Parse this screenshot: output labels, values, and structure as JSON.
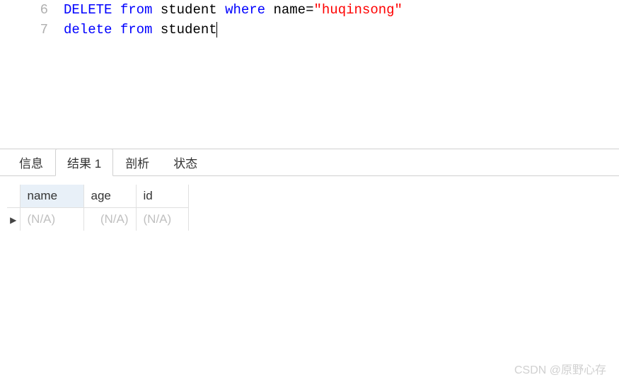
{
  "editor": {
    "lines": [
      {
        "num": "6",
        "tokens": [
          {
            "t": "DELETE",
            "c": "kw"
          },
          {
            "t": " ",
            "c": "ident"
          },
          {
            "t": "from",
            "c": "kw"
          },
          {
            "t": " student ",
            "c": "ident"
          },
          {
            "t": "where",
            "c": "kw"
          },
          {
            "t": " name",
            "c": "ident"
          },
          {
            "t": "=",
            "c": "ident"
          },
          {
            "t": "\"huqinsong\"",
            "c": "str"
          }
        ]
      },
      {
        "num": "7",
        "tokens": [
          {
            "t": "delete from",
            "c": "kw"
          },
          {
            "t": " student",
            "c": "ident"
          }
        ],
        "cursor": true
      }
    ]
  },
  "tabs": {
    "items": [
      {
        "label": "信息",
        "active": false
      },
      {
        "label": "结果 1",
        "active": true
      },
      {
        "label": "剖析",
        "active": false
      },
      {
        "label": "状态",
        "active": false
      }
    ]
  },
  "results": {
    "columns": [
      "name",
      "age",
      "id"
    ],
    "selected_column": 0,
    "rows": [
      {
        "name": "(N/A)",
        "age": "(N/A)",
        "id": "(N/A)"
      }
    ],
    "row_marker": "▶"
  },
  "watermark": "CSDN @原野心存"
}
